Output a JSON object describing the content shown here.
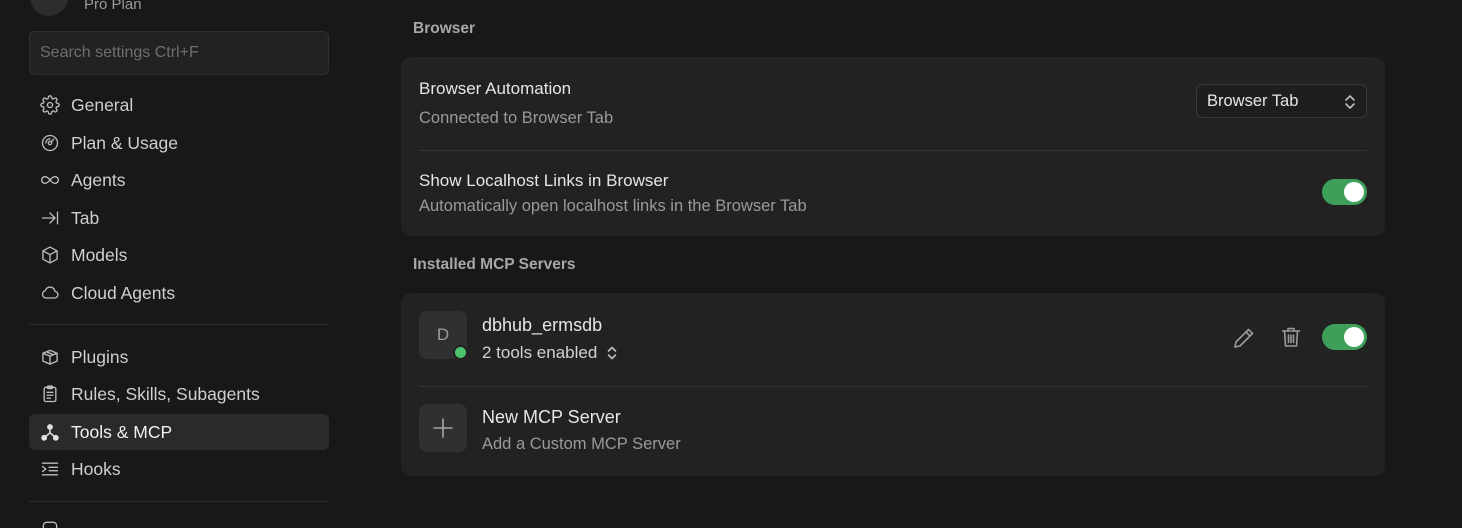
{
  "sidebar": {
    "plan_label": "Pro Plan",
    "search_placeholder": "Search settings Ctrl+F",
    "group1": [
      {
        "label": "General",
        "icon": "gear-icon"
      },
      {
        "label": "Plan & Usage",
        "icon": "gauge-icon"
      },
      {
        "label": "Agents",
        "icon": "infinity-icon"
      },
      {
        "label": "Tab",
        "icon": "arrow-right-bar-icon"
      },
      {
        "label": "Models",
        "icon": "cube-icon"
      },
      {
        "label": "Cloud Agents",
        "icon": "cloud-icon"
      }
    ],
    "group2": [
      {
        "label": "Plugins",
        "icon": "package-icon"
      },
      {
        "label": "Rules, Skills, Subagents",
        "icon": "clipboard-icon"
      },
      {
        "label": "Tools & MCP",
        "icon": "nodes-icon",
        "active": true
      },
      {
        "label": "Hooks",
        "icon": "list-arrow-icon"
      }
    ]
  },
  "browser_section": {
    "title": "Browser",
    "automation": {
      "title": "Browser Automation",
      "subtitle": "Connected to Browser Tab",
      "selected": "Browser Tab"
    },
    "localhost": {
      "title": "Show Localhost Links in Browser",
      "subtitle": "Automatically open localhost links in the Browser Tab",
      "enabled": true
    }
  },
  "mcp_section": {
    "title": "Installed MCP Servers",
    "servers": [
      {
        "initial": "D",
        "name": "dbhub_ermsdb",
        "tools": "2 tools enabled",
        "status": "connected",
        "enabled": true
      }
    ],
    "new_server": {
      "title": "New MCP Server",
      "subtitle": "Add a Custom MCP Server"
    }
  },
  "colors": {
    "accent_green": "#3e9f58",
    "status_green": "#4cc26c",
    "background": "#181818",
    "card": "#222222"
  }
}
